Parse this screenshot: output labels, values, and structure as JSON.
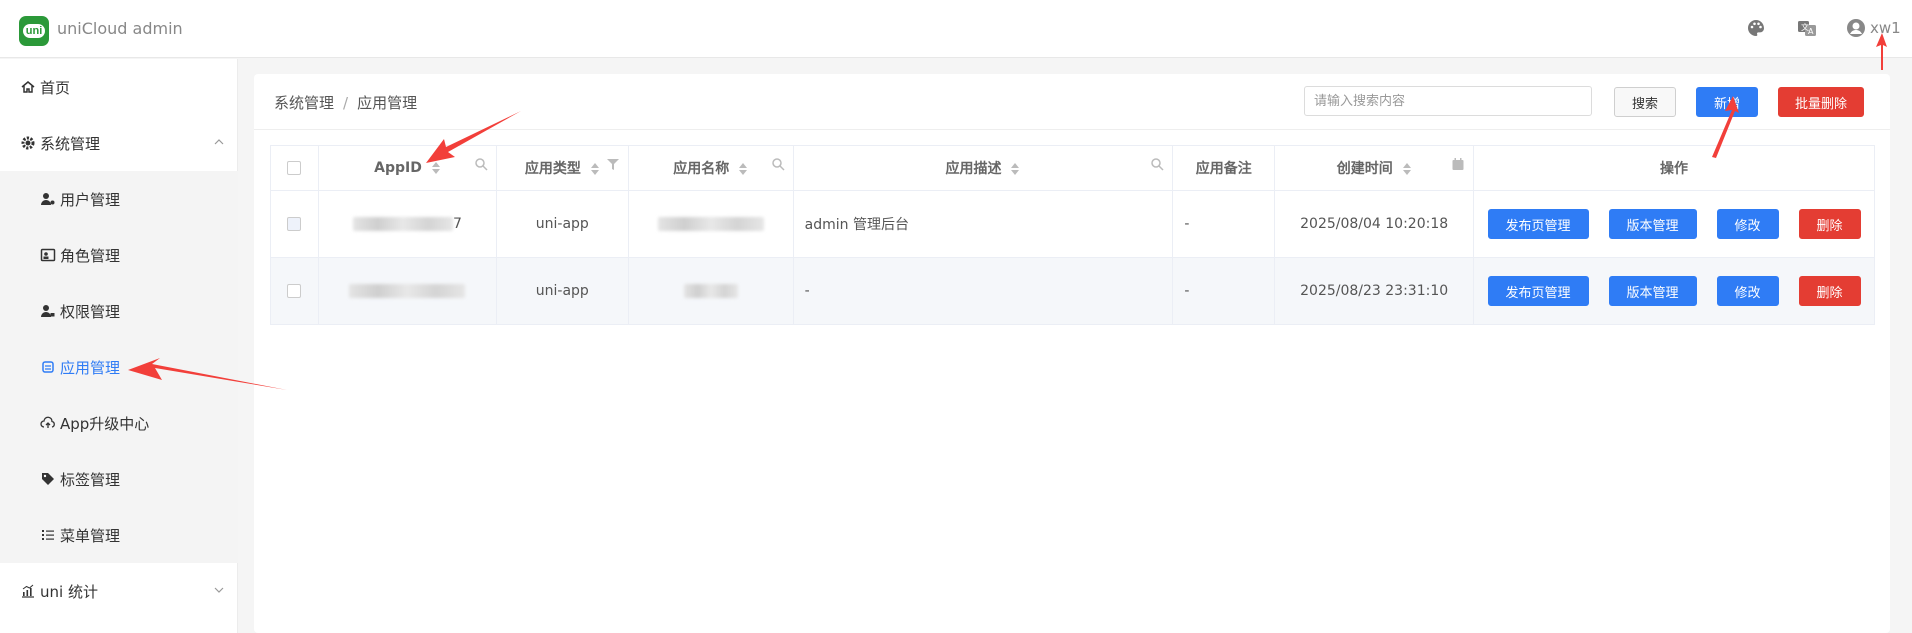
{
  "app": {
    "title": "uniCloud admin",
    "logo_text": "uni",
    "user_name": "xw1"
  },
  "header_icons": [
    "palette-icon",
    "translate-icon",
    "user-avatar-icon"
  ],
  "sidebar": {
    "items": [
      {
        "label": "首页",
        "icon": "home-icon",
        "level": 1
      },
      {
        "label": "系统管理",
        "icon": "gear-icon",
        "level": 1,
        "expanded": true
      },
      {
        "label": "用户管理",
        "icon": "user-gear-icon",
        "level": 2
      },
      {
        "label": "角色管理",
        "icon": "id-card-icon",
        "level": 2
      },
      {
        "label": "权限管理",
        "icon": "user-lock-icon",
        "level": 2
      },
      {
        "label": "应用管理",
        "icon": "app-icon",
        "level": 2,
        "active": true
      },
      {
        "label": "App升级中心",
        "icon": "cloud-upload-icon",
        "level": 2
      },
      {
        "label": "标签管理",
        "icon": "tag-icon",
        "level": 2
      },
      {
        "label": "菜单管理",
        "icon": "list-icon",
        "level": 2
      },
      {
        "label": "uni 统计",
        "icon": "chart-icon",
        "level": 1,
        "expanded": false
      }
    ]
  },
  "breadcrumb": {
    "parent": "系统管理",
    "separator": "/",
    "current": "应用管理"
  },
  "toolbar": {
    "search_placeholder": "请输入搜索内容",
    "search_label": "搜索",
    "add_label": "新增",
    "batch_delete_label": "批量删除"
  },
  "table": {
    "columns": [
      "AppID",
      "应用类型",
      "应用名称",
      "应用描述",
      "应用备注",
      "创建时间",
      "操作"
    ],
    "rows": [
      {
        "appid_visible_suffix": "7",
        "type": "uni-app",
        "description": "admin 管理后台",
        "remark": "-",
        "created": "2025/08/04 10:20:18"
      },
      {
        "appid_visible_suffix": "",
        "type": "uni-app",
        "description": "-",
        "remark": "-",
        "created": "2025/08/23 23:31:10"
      }
    ],
    "row_actions": {
      "publish_page": "发布页管理",
      "version": "版本管理",
      "edit": "修改",
      "delete": "删除"
    }
  },
  "colors": {
    "primary": "#2f7cf5",
    "danger": "#e43d33",
    "brand": "#2b9939",
    "annotation": "#f23f3a"
  }
}
